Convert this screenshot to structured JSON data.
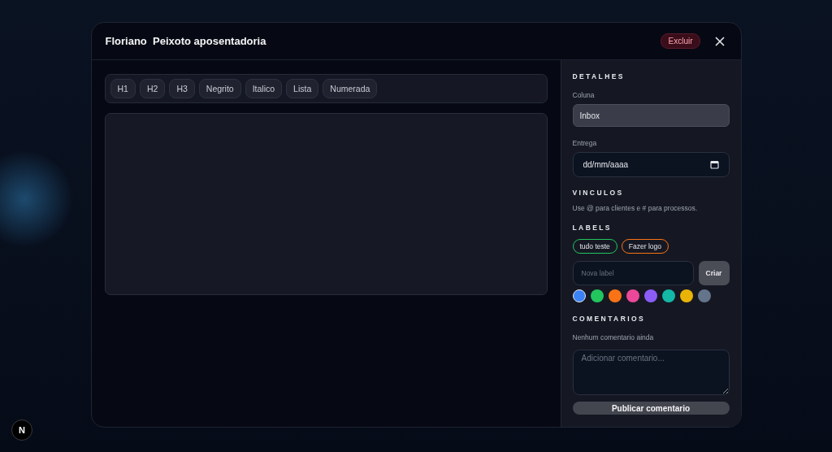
{
  "dialog": {
    "title": "Floriano  Peixoto aposentadoria",
    "delete_button": "Excluir"
  },
  "toolbar": [
    "H1",
    "H2",
    "H3",
    "Negrito",
    "Italico",
    "Lista",
    "Numerada"
  ],
  "details": {
    "heading": "DETALHES",
    "column_label": "Coluna",
    "column_value": "Inbox",
    "due_label": "Entrega",
    "due_placeholder": "dd/mm/aaaa"
  },
  "links": {
    "heading": "VINCULOS",
    "hint": "Use @ para clientes e # para processos."
  },
  "labels": {
    "heading": "LABELS",
    "items": [
      {
        "name": "tudo teste",
        "color": "#22c55e"
      },
      {
        "name": "Fazer logo",
        "color": "#f97316"
      }
    ],
    "new_placeholder": "Nova label",
    "create_button": "Criar",
    "swatches": [
      {
        "color": "#3b82f6",
        "selected": true
      },
      {
        "color": "#22c55e",
        "selected": false
      },
      {
        "color": "#f97316",
        "selected": false
      },
      {
        "color": "#ec4899",
        "selected": false
      },
      {
        "color": "#8b5cf6",
        "selected": false
      },
      {
        "color": "#14b8a6",
        "selected": false
      },
      {
        "color": "#eab308",
        "selected": false
      },
      {
        "color": "#64748b",
        "selected": false
      }
    ]
  },
  "comments": {
    "heading": "COMENTARIOS",
    "empty": "Nenhum comentario ainda",
    "placeholder": "Adicionar comentario...",
    "submit": "Publicar comentario"
  },
  "corner_badge": "N"
}
